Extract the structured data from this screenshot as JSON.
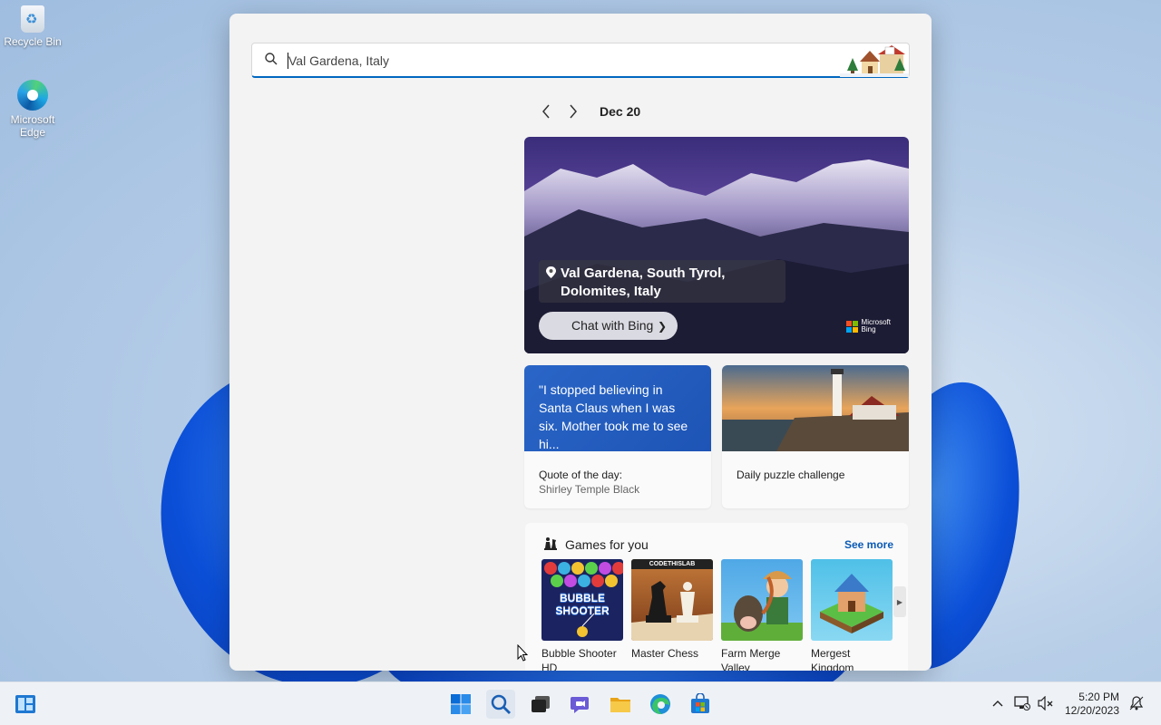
{
  "desktop": {
    "icons": [
      {
        "label": "Recycle Bin"
      },
      {
        "label": "Microsoft Edge"
      }
    ]
  },
  "search": {
    "value": "Val Gardena, Italy",
    "icon": "search-icon"
  },
  "date_nav": {
    "date": "Dec 20"
  },
  "hero": {
    "location": "Val Gardena, South Tyrol, Dolomites, Italy",
    "chat_button": "Chat with Bing",
    "brand_line1": "Microsoft",
    "brand_line2": "Bing"
  },
  "quote_card": {
    "quote": "\"I stopped believing in Santa Claus when I was six. Mother took me to see hi...",
    "caption": "Quote of the day:",
    "author": "Shirley Temple Black"
  },
  "puzzle_card": {
    "caption": "Daily puzzle challenge"
  },
  "games": {
    "title": "Games for you",
    "see_more": "See more",
    "items": [
      {
        "name": "Bubble Shooter HD",
        "thumb_text": "BUBBLE SHOOTER"
      },
      {
        "name": "Master Chess",
        "thumb_text": "CODETHISLAB"
      },
      {
        "name": "Farm Merge Valley",
        "thumb_text": ""
      },
      {
        "name": "Mergest Kingdom",
        "thumb_text": ""
      }
    ]
  },
  "taskbar": {
    "apps": [
      "widgets-icon",
      "start-icon",
      "search-icon",
      "task-view-icon",
      "teams-chat-icon",
      "file-explorer-icon",
      "edge-icon",
      "store-icon"
    ]
  },
  "clock": {
    "time": "5:20 PM",
    "date": "12/20/2023"
  },
  "colors": {
    "accent": "#0067c0",
    "quote_card": "#2a66c7",
    "see_more": "#0a5ab5"
  }
}
